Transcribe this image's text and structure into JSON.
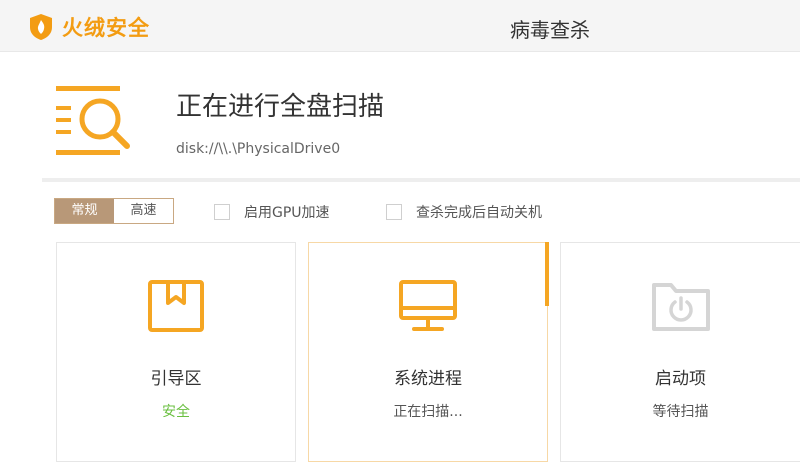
{
  "app": {
    "name": "火绒安全"
  },
  "window": {
    "title": "病毒查杀"
  },
  "scan": {
    "title": "正在进行全盘扫描",
    "path": "disk://\\\\.\\PhysicalDrive0"
  },
  "options": {
    "modes": [
      {
        "label": "常规",
        "selected": true
      },
      {
        "label": "高速",
        "selected": false
      }
    ],
    "gpu_accel": {
      "label": "启用GPU加速",
      "checked": false
    },
    "auto_shutdown": {
      "label": "查杀完成后自动关机",
      "checked": false
    }
  },
  "cards": [
    {
      "name": "引导区",
      "status": "安全",
      "icon": "boot-sector-icon"
    },
    {
      "name": "系统进程",
      "status": "正在扫描...",
      "icon": "monitor-icon"
    },
    {
      "name": "启动项",
      "status": "等待扫描",
      "icon": "startup-folder-icon"
    }
  ],
  "colors": {
    "accent": "#f5a623",
    "mode_active": "#b89878",
    "safe": "#6abf40",
    "icon_idle": "#d5d5d5"
  }
}
